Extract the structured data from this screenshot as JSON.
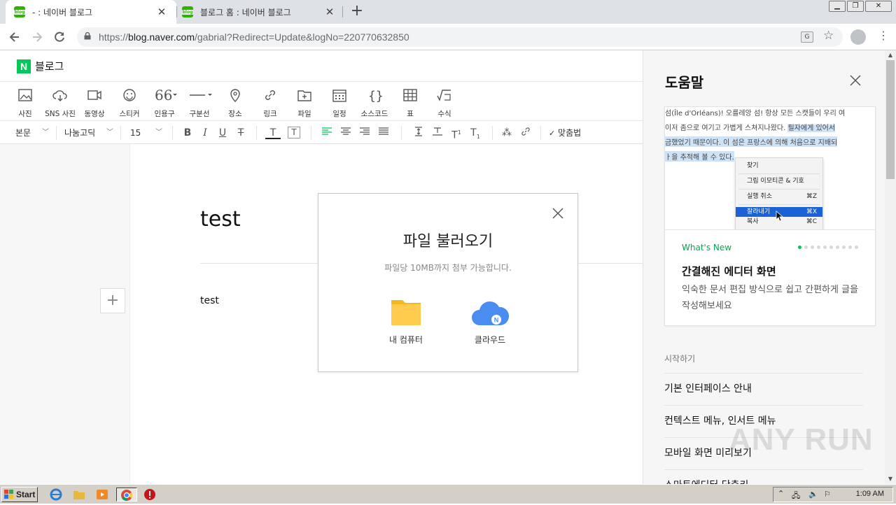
{
  "browser": {
    "tabs": [
      {
        "title": "- : 네이버 블로그",
        "active": true
      },
      {
        "title": "블로그 홈 : 네이버 블로그",
        "active": false
      }
    ],
    "url_prefix": "https://",
    "url_host": "blog.naver.com",
    "url_path": "/gabrial?Redirect=Update&logNo=220770632850",
    "favicon_text": "blog"
  },
  "editor": {
    "brand_logo": "N",
    "brand_name": "블로그",
    "toolbar": [
      {
        "label": "사진",
        "icon": "photo-icon"
      },
      {
        "label": "SNS 사진",
        "icon": "cloud-download-icon"
      },
      {
        "label": "동영상",
        "icon": "video-icon"
      },
      {
        "label": "스티커",
        "icon": "smile-icon"
      },
      {
        "label": "인용구",
        "icon": "quote-icon"
      },
      {
        "label": "구분선",
        "icon": "divider-icon"
      },
      {
        "label": "장소",
        "icon": "map-pin-icon"
      },
      {
        "label": "링크",
        "icon": "link-icon"
      },
      {
        "label": "파일",
        "icon": "file-icon"
      },
      {
        "label": "일정",
        "icon": "calendar-icon"
      },
      {
        "label": "소스코드",
        "icon": "code-icon"
      },
      {
        "label": "표",
        "icon": "table-icon"
      },
      {
        "label": "수식",
        "icon": "formula-icon"
      }
    ],
    "format": {
      "paragraph_style": "본문",
      "font_family": "나눔고딕",
      "font_size": "15",
      "spellcheck": "맞춤법"
    },
    "doc_title": "test",
    "doc_body": "test"
  },
  "modal": {
    "title": "파일 불러오기",
    "subtitle": "파일당 10MB까지 첨부 가능합니다.",
    "option_computer": "내 컴퓨터",
    "option_cloud": "클라우드",
    "cloud_badge": "N",
    "folder_color": "#ffcc4d",
    "cloud_color": "#4a8cf0"
  },
  "help": {
    "title": "도움말",
    "card": {
      "shot_lines": [
        "섬(Île d'Orléans)! 오를레앙 섬! 항상 모든 스캣들이 우리 여",
        "이저 좀으로 여기고 가볍게 스쳐지나왔다.",
        "필자에게 있어서",
        "금했었기 때문이다. 이 섬은 프랑스에 의해 처음으로 지배되",
        "ㅏ을 추적해 볼 수 있다."
      ],
      "context_menu": [
        {
          "label": "찾기",
          "shortcut": ""
        },
        {
          "label": "그림 이모티콘 & 기호",
          "shortcut": ""
        },
        {
          "label": "실행 취소",
          "shortcut": "⌘Z"
        },
        {
          "label": "잘라내기",
          "shortcut": "⌘X"
        },
        {
          "label": "복사",
          "shortcut": "⌘C"
        }
      ],
      "tag": "What's New",
      "heading": "간결해진 에디터 화면",
      "description": "익숙한 문서 편집 방식으로 쉽고 간편하게 글을 작성해보세요",
      "page_count": 10,
      "page_current": 1
    },
    "section_label": "시작하기",
    "items": [
      "기본 인터페이스 안내",
      "컨텍스트 메뉴, 인서트 메뉴",
      "모바일 화면 미리보기",
      "스마트에디터 단축키"
    ],
    "watermark": "ANY RUN"
  },
  "taskbar": {
    "start_label": "Start",
    "clock": "1:09 AM"
  },
  "colors": {
    "naver_green": "#03c75a",
    "accent_blue": "#1a62d6"
  }
}
